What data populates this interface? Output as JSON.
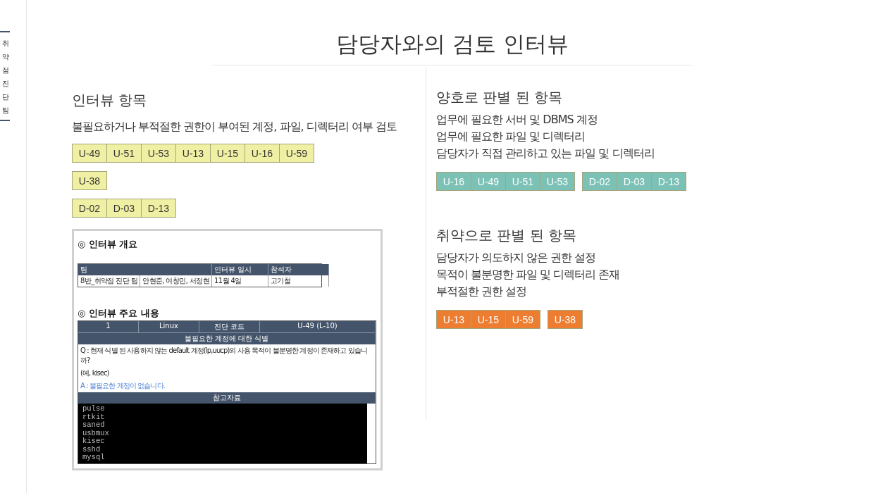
{
  "side_label": "취약점진단팀",
  "title": "담당자와의 검토 인터뷰",
  "left": {
    "heading": "인터뷰 항목",
    "description": "불필요하거나 부적절한 권한이 부여된 계정, 파일, 디렉터리 여부 검토",
    "tag_rows": [
      {
        "color": "#f0f0a4",
        "groups": [
          [
            "U-49",
            "U-51",
            "U-53",
            "U-13",
            "U-15",
            "U-16",
            "U-59"
          ]
        ]
      },
      {
        "color": "#f0f0a4",
        "groups": [
          [
            "U-38"
          ]
        ]
      },
      {
        "color": "#f0f0a4",
        "groups": [
          [
            "D-02",
            "D-03",
            "D-13"
          ]
        ]
      }
    ],
    "document": {
      "bullet": "◎",
      "overview_heading": "인터뷰 개요",
      "overview_header": [
        "팀",
        "인터뷰 일시",
        "참석자"
      ],
      "overview_row": [
        "8반_취약점 진단 팀",
        "안현준, 여창민, 서정현",
        "11월 4일",
        "고기철"
      ],
      "content_heading": "인터뷰 주요 내용",
      "content_header": [
        "1",
        "Linux",
        "진단 코드",
        "U-49 (L-10)"
      ],
      "topic": "불필요한 계정에 대한 식별",
      "question": "Q : 현재 식별 된 사용하지 않는 default 계정(lp,uucp)외 사용 목적이 불분명한 계정이 존재하고 있습니까?",
      "example": "(예, kisec)",
      "answer": "A : 불필요한 계정이 없습니다.",
      "reference_heading": "참고자료",
      "terminal_lines": [
        "pulse",
        "rtkit",
        "saned",
        "usbmux",
        "kisec",
        "sshd",
        "mysql"
      ]
    }
  },
  "right": [
    {
      "heading": "양호로 판별 된 항목",
      "lines": [
        "업무에 필요한 서버 및 DBMS 계정",
        "업무에 필요한 파일 및 디렉터리",
        "담당자가 직접 관리하고 있는 파일 및 디렉터리"
      ],
      "tag_rows": [
        {
          "color": "#7cc1b5",
          "groups": [
            [
              "U-16",
              "U-49",
              "U-51",
              "U-53"
            ],
            [
              "D-02",
              "D-03",
              "D-13"
            ]
          ]
        }
      ]
    },
    {
      "heading": "취약으로 판별 된 항목",
      "lines": [
        "담당자가 의도하지 않은 권한 설정",
        "목적이 불분명한 파일 및 디렉터리 존재",
        "부적절한 권한 설정"
      ],
      "tag_rows": [
        {
          "color": "#ed7d31",
          "groups": [
            [
              "U-13",
              "U-15",
              "U-59"
            ],
            [
              "U-38"
            ]
          ]
        }
      ]
    }
  ]
}
